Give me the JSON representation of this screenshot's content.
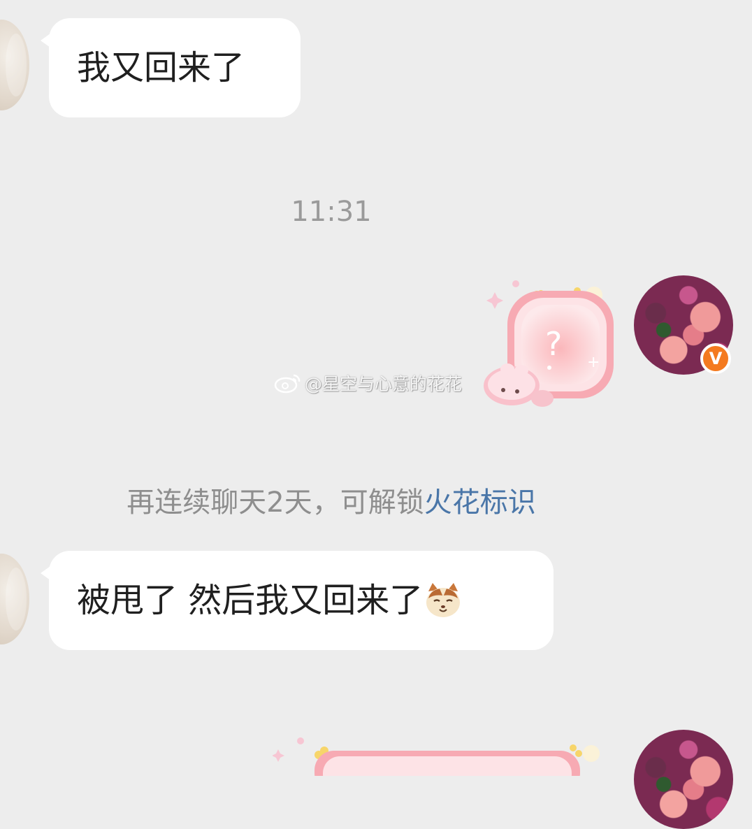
{
  "messages": {
    "first": {
      "text": "我又回来了"
    },
    "timestamp": "11:31",
    "watermark": "@星空与心意的花花",
    "system_notice": {
      "prefix": "再连续聊天2天，可解锁",
      "link": "火花标识"
    },
    "second": {
      "text": "被甩了 然后我又回来了"
    }
  },
  "icons": {
    "verified_badge": "v-badge-icon",
    "sticker": "pink-bubble-question-sticker",
    "emoji": "cat-face-emoji",
    "weibo": "weibo-icon"
  },
  "colors": {
    "background": "#ededed",
    "bubble": "#ffffff",
    "link": "#4a76a8",
    "badge": "#f47a1f"
  }
}
